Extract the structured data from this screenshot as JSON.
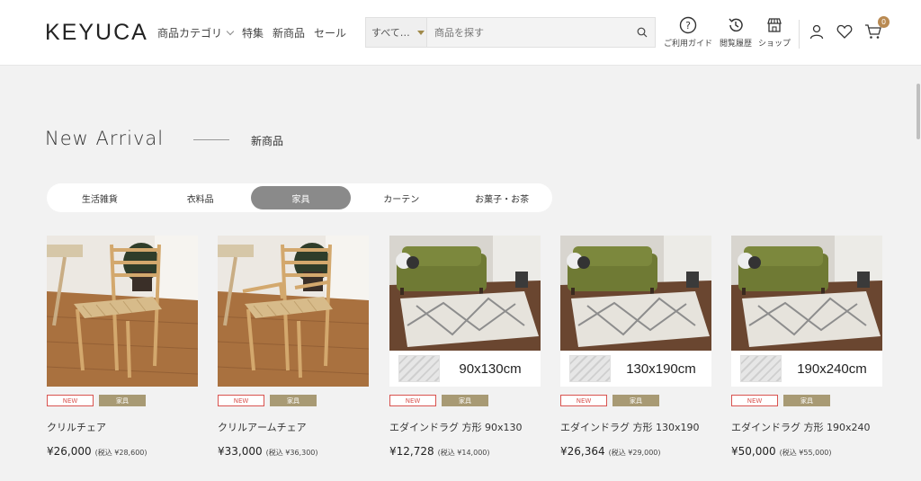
{
  "header": {
    "logo": "KEYUCA",
    "nav": [
      {
        "label": "商品カテゴリ",
        "has_dropdown": true
      },
      {
        "label": "特集"
      },
      {
        "label": "新商品"
      },
      {
        "label": "セール"
      }
    ],
    "search": {
      "scope": "すべて…",
      "placeholder": "商品を探す",
      "value": ""
    },
    "tools": {
      "guide": "ご利用ガイド",
      "history": "閲覧履歴",
      "shop": "ショップ"
    },
    "cart_count": "0",
    "accent_color": "#b98a52"
  },
  "section": {
    "title": "New Arrival",
    "subtitle": "新商品"
  },
  "tabs": [
    {
      "label": "生活雑貨",
      "active": false
    },
    {
      "label": "衣料品",
      "active": false
    },
    {
      "label": "家具",
      "active": true
    },
    {
      "label": "カーテン",
      "active": false
    },
    {
      "label": "お菓子・お茶",
      "active": false
    }
  ],
  "products": [
    {
      "name": "クリルチェア",
      "price": "¥26,000",
      "tax": "(税込 ¥28,600)",
      "tag_new": "NEW",
      "tag_cat": "家具",
      "image": "chair",
      "size_label": ""
    },
    {
      "name": "クリルアームチェア",
      "price": "¥33,000",
      "tax": "(税込 ¥36,300)",
      "tag_new": "NEW",
      "tag_cat": "家具",
      "image": "armchair",
      "size_label": ""
    },
    {
      "name": "エダインドラグ 方形 90x130",
      "price": "¥12,728",
      "tax": "(税込 ¥14,000)",
      "tag_new": "NEW",
      "tag_cat": "家具",
      "image": "rug",
      "size_label": "90x130cm"
    },
    {
      "name": "エダインドラグ 方形 130x190",
      "price": "¥26,364",
      "tax": "(税込 ¥29,000)",
      "tag_new": "NEW",
      "tag_cat": "家具",
      "image": "rug",
      "size_label": "130x190cm"
    },
    {
      "name": "エダインドラグ 方形 190x240",
      "price": "¥50,000",
      "tax": "(税込 ¥55,000)",
      "tag_new": "NEW",
      "tag_cat": "家具",
      "image": "rug",
      "size_label": "190x240cm"
    }
  ]
}
